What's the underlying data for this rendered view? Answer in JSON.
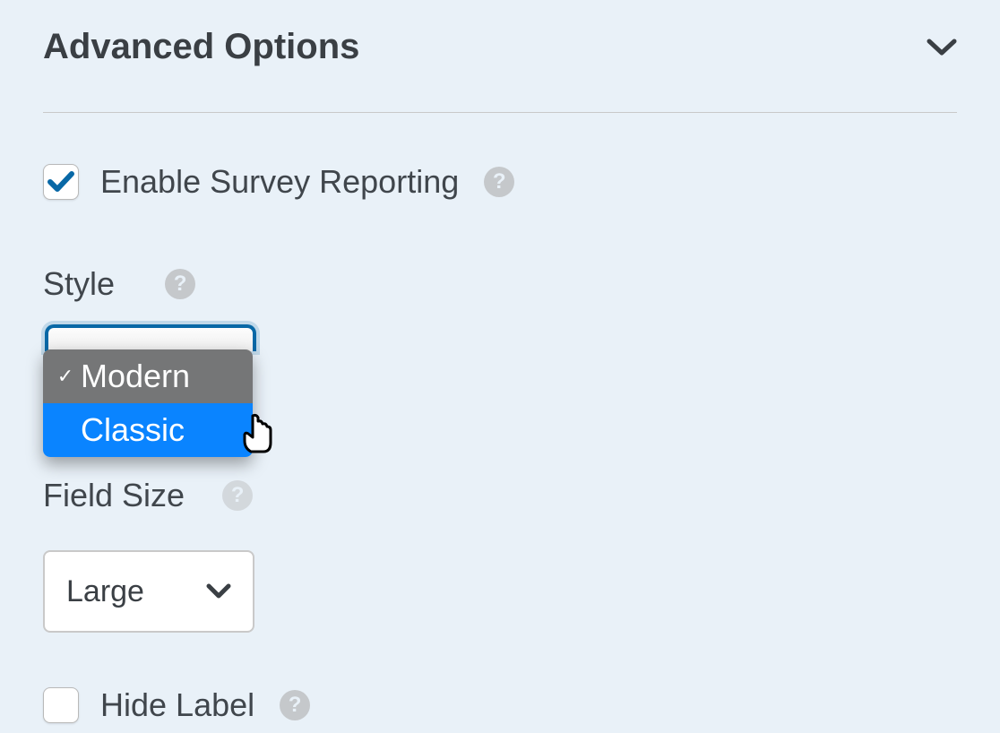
{
  "header": {
    "title": "Advanced Options"
  },
  "enable_survey": {
    "label": "Enable Survey Reporting",
    "checked": true
  },
  "style": {
    "label": "Style",
    "options": [
      "Modern",
      "Classic"
    ],
    "selected": "Modern",
    "highlighted": "Classic"
  },
  "field_size": {
    "label": "Field Size",
    "value": "Large"
  },
  "hide_label": {
    "label": "Hide Label",
    "checked": false
  },
  "help_tooltip": "?"
}
